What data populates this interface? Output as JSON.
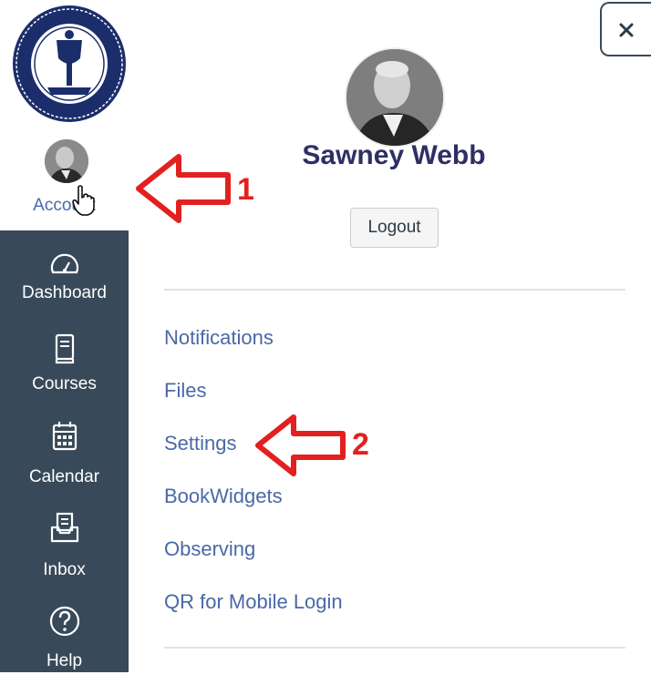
{
  "account": {
    "label": "Account"
  },
  "nav": {
    "items": [
      {
        "label": "Dashboard",
        "icon": "dashboard-icon"
      },
      {
        "label": "Courses",
        "icon": "courses-icon"
      },
      {
        "label": "Calendar",
        "icon": "calendar-icon"
      },
      {
        "label": "Inbox",
        "icon": "inbox-icon"
      },
      {
        "label": "Help",
        "icon": "help-icon"
      }
    ]
  },
  "tray": {
    "user_name": "Sawney Webb",
    "logout_label": "Logout",
    "links": [
      {
        "label": "Notifications"
      },
      {
        "label": "Files"
      },
      {
        "label": "Settings"
      },
      {
        "label": "BookWidgets"
      },
      {
        "label": "Observing"
      },
      {
        "label": "QR for Mobile Login"
      }
    ]
  },
  "annotations": {
    "arrow1": "1",
    "arrow2": "2"
  },
  "colors": {
    "nav_bg": "#384a59",
    "link": "#4a68a8",
    "name": "#2f2f66",
    "annotation": "#e32020"
  }
}
